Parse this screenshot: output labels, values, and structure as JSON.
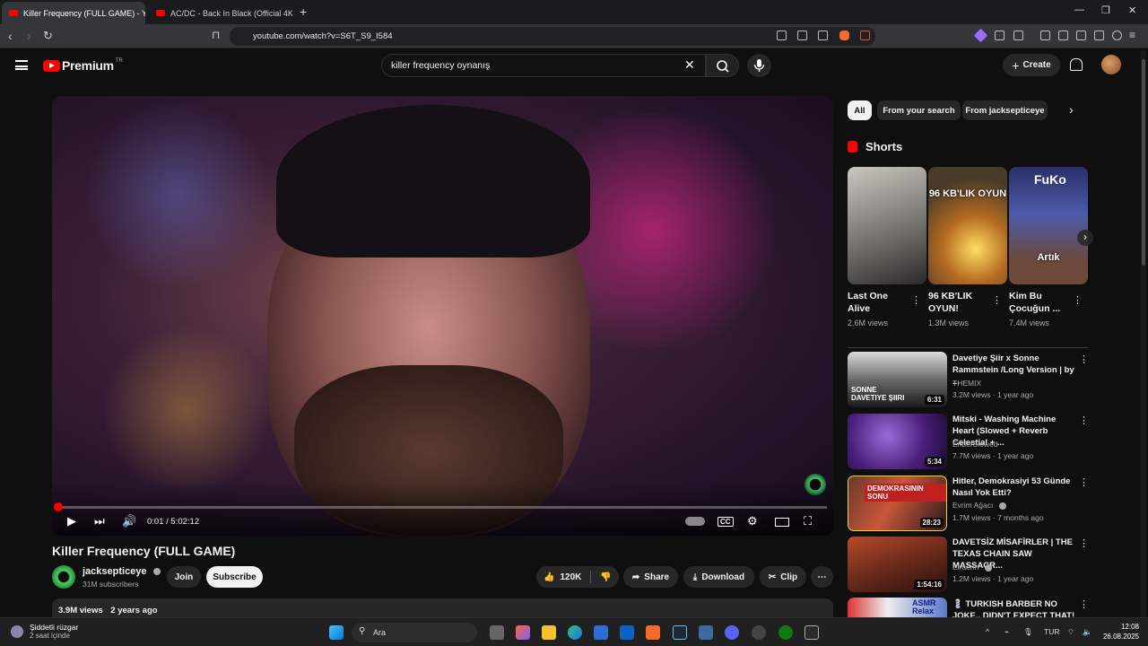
{
  "browser": {
    "tabs": [
      {
        "title": "Killer Frequency (FULL GAME) - Y",
        "active": true
      },
      {
        "title": "AC/DC - Back In Black (Official 4K Vid",
        "active": false
      }
    ],
    "url": "youtube.com/watch?v=S6T_S9_I584"
  },
  "header": {
    "logo": "Premium",
    "logo_badge": "TR",
    "search_value": "killer frequency oynanış",
    "create_label": "Create"
  },
  "player": {
    "progress_fraction": 0.0001,
    "time": "0:01 / 5:02:12"
  },
  "video": {
    "title": "Killer Frequency (FULL GAME)",
    "channel": "jacksepticeye",
    "subscribers": "31M subscribers",
    "join_label": "Join",
    "subscribe_label": "Subscribe",
    "likes": "120K",
    "share_label": "Share",
    "download_label": "Download",
    "clip_label": "Clip",
    "views": "3.9M views",
    "age": "2 years ago"
  },
  "chips": [
    "All",
    "From your search",
    "From jacksepticeye"
  ],
  "shorts": {
    "heading": "Shorts",
    "items": [
      {
        "title": "Last One Alive",
        "views": "2.6M views",
        "overlay": ""
      },
      {
        "title": "96 KB'LIK OYUN!",
        "views": "1.3M views",
        "overlay": "96 KB'LIK OYUN"
      },
      {
        "title": "Kim Bu Çocuğun ...",
        "views": "7.4M views",
        "overlay": "Artık"
      }
    ]
  },
  "related": [
    {
      "title": "Davetiye Şiir x Sonne Rammstein /Long Version | by ...",
      "channel": "THEMIX",
      "meta": "3.2M views · 1 year ago",
      "duration": "6:31",
      "thumb_text": "SONNE DAVETIYE ŞIIRI"
    },
    {
      "title": "Mitski - Washing Machine Heart (Slowed + Reverb Celestial + ...",
      "channel": "EnderSlowed",
      "meta": "7.7M views · 1 year ago",
      "duration": "5:34",
      "thumb_text": ""
    },
    {
      "title": "Hitler, Demokrasiyi 53 Günde Nasıl Yok Etti?",
      "channel": "Evrim Ağacı",
      "meta": "1.7M views · 7 months ago",
      "duration": "28:23",
      "thumb_text": "DEMOKRASININ SONU"
    },
    {
      "title": "DAVETSİZ MİSAFİRLER | THE TEXAS CHAIN SAW MASSACR...",
      "channel": "Elraenn",
      "meta": "1.2M views · 1 year ago",
      "duration": "1:54:16",
      "thumb_text": ""
    },
    {
      "title": "💈 TURKISH BARBER NO JOKE.. DIDN'T EXPECT THAT! ASMR ...",
      "channel": "",
      "meta": "",
      "duration": "",
      "thumb_text": "ASMR Relax"
    }
  ],
  "taskbar": {
    "weather_title": "Şiddetli rüzgar",
    "weather_sub": "2 saat içinde",
    "search_label": "Ara",
    "lang": "TUR",
    "time": "12:08",
    "date": "26.08.2025"
  },
  "colors": {
    "accent": "#ff0000",
    "bg": "#0f0f0f",
    "chip": "#272727"
  }
}
